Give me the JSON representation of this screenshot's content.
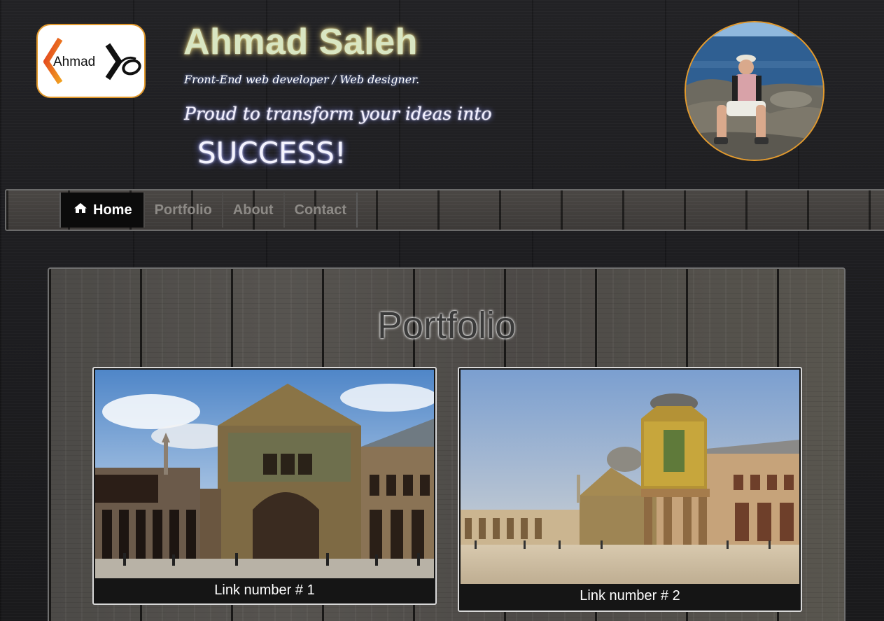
{
  "header": {
    "logo_text": "Ahmad",
    "title": "Ahmad Saleh",
    "tagline": "Front-End web developer / Web designer.",
    "slogan": "Proud to transform your ideas into",
    "slogan_emphasis": "SUCCESS!"
  },
  "nav": {
    "items": [
      {
        "label": "Home",
        "icon": "home-icon",
        "active": true
      },
      {
        "label": "Portfolio",
        "active": false
      },
      {
        "label": "About",
        "active": false
      },
      {
        "label": "Contact",
        "active": false
      }
    ]
  },
  "portfolio": {
    "title": "Portfolio",
    "cards": [
      {
        "caption": "Link number # 1"
      },
      {
        "caption": "Link number # 2"
      }
    ]
  },
  "colors": {
    "accent_orange": "#e39a2d",
    "title_glow": "#d9e6c2",
    "nav_active_bg": "#0b0b0b"
  }
}
